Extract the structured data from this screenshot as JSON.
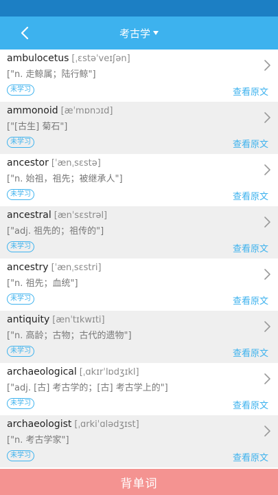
{
  "nav": {
    "title": "考古学"
  },
  "words": [
    {
      "word": "ambulocetus",
      "phonetic": "[ˌɛstəˈveɪʃən]",
      "meaning": "[\"n. 走鲸属；陆行鲸\"]",
      "status": "未学习",
      "link": "查看原文"
    },
    {
      "word": "ammonoid",
      "phonetic": "[æˈmɒnɔɪd]",
      "meaning": "[\"[古生] 菊石\"]",
      "status": "未学习",
      "link": "查看原文"
    },
    {
      "word": "ancestor",
      "phonetic": "[ˈænˌsɛstə]",
      "meaning": "[\"n. 始祖，祖先；被继承人\"]",
      "status": "未学习",
      "link": "查看原文"
    },
    {
      "word": "ancestral",
      "phonetic": "[ænˈsɛstrəl]",
      "meaning": "[\"adj. 祖先的；祖传的\"]",
      "status": "未学习",
      "link": "查看原文"
    },
    {
      "word": "ancestry",
      "phonetic": "[ˈænˌsɛstri]",
      "meaning": "[\"n. 祖先；血统\"]",
      "status": "未学习",
      "link": "查看原文"
    },
    {
      "word": "antiquity",
      "phonetic": "[ænˈtɪkwɪti]",
      "meaning": "[\"n. 高龄；古物；古代的遗物\"]",
      "status": "未学习",
      "link": "查看原文"
    },
    {
      "word": "archaeological",
      "phonetic": "[ˌɑkɪrˈlɒdʒɪkl]",
      "meaning": "[\"adj. [古] 考古学的；[古] 考古学上的\"]",
      "status": "未学习",
      "link": "查看原文"
    },
    {
      "word": "archaeologist",
      "phonetic": "[ˌɑrkiˈɑlədʒɪst]",
      "meaning": "[\"n. 考古学家\"]",
      "status": "未学习",
      "link": "查看原文"
    }
  ],
  "bottom": {
    "label": "背单词"
  },
  "colors": {
    "accent": "#3db2ee",
    "statusBar": "#1c7fc4",
    "bottomBar": "#f49391"
  }
}
